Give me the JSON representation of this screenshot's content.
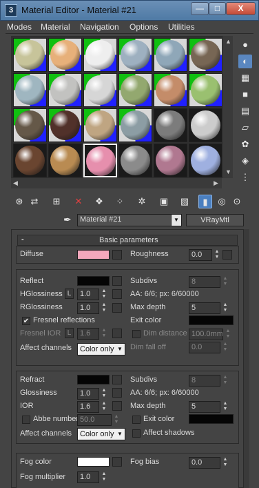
{
  "window": {
    "title": "Material Editor - Material #21",
    "app_icon": "3",
    "min_label": "—",
    "max_label": "□",
    "close_label": "X"
  },
  "menu": [
    "Modes",
    "Material",
    "Navigation",
    "Options",
    "Utilities"
  ],
  "slots_rows": [
    [
      {
        "c": "#c7c49a",
        "used": true
      },
      {
        "c": "#e7b07a",
        "used": true
      },
      {
        "c": "#eeeeee",
        "used": true
      },
      {
        "c": "#9eb0c0",
        "used": true
      },
      {
        "c": "#8fa7b8",
        "used": true
      },
      {
        "c": "#776654",
        "used": true
      }
    ],
    [
      {
        "c": "#9fb6c0",
        "used": true
      },
      {
        "c": "#c2c2c0",
        "used": true
      },
      {
        "c": "#d6d6d6",
        "used": true
      },
      {
        "c": "#93a86f",
        "used": true
      },
      {
        "c": "#c48c69",
        "used": true
      },
      {
        "c": "#9ac070",
        "used": true
      }
    ],
    [
      {
        "c": "#655848",
        "used": true
      },
      {
        "c": "#51312a",
        "used": true
      },
      {
        "c": "#bfa582",
        "used": true
      },
      {
        "c": "#8c9da4",
        "used": true
      },
      {
        "c": "#7c7c7c",
        "used": false
      },
      {
        "c": "#cccccc",
        "used": false
      }
    ],
    [
      {
        "c": "#6a4530",
        "used": false
      },
      {
        "c": "#b98b52",
        "used": false
      },
      {
        "c": "#e68fad",
        "used": false,
        "selected": true
      },
      {
        "c": "#8b8b8b",
        "used": false
      },
      {
        "c": "#b07890",
        "used": false
      },
      {
        "c": "#9fb0e0",
        "used": false
      }
    ]
  ],
  "side_tools": [
    {
      "name": "sample-type-icon",
      "glyph": "●"
    },
    {
      "name": "backlight-icon",
      "glyph": "◐"
    },
    {
      "name": "background-icon",
      "glyph": "▦"
    },
    {
      "name": "sample-uv-icon",
      "glyph": "■"
    },
    {
      "name": "video-color-icon",
      "glyph": "▤"
    },
    {
      "name": "make-preview-icon",
      "glyph": "▱"
    },
    {
      "name": "options-icon",
      "glyph": "✿"
    },
    {
      "name": "select-by-material-icon",
      "glyph": "◈"
    },
    {
      "name": "material-map-navigator-icon",
      "glyph": "⋮"
    }
  ],
  "toolbar": [
    {
      "name": "get-material-icon",
      "glyph": "⊛"
    },
    {
      "name": "put-to-scene-icon",
      "glyph": "⇄"
    },
    {
      "name": "assign-to-selection-icon",
      "glyph": "⊞"
    },
    {
      "name": "reset-map-icon",
      "glyph": "✕",
      "color": "#e04040"
    },
    {
      "name": "make-unique-icon",
      "glyph": "❖"
    },
    {
      "name": "put-to-library-icon",
      "glyph": "⁘"
    },
    {
      "name": "material-id-channel-icon",
      "glyph": "✲"
    },
    {
      "name": "show-shaded-icon",
      "glyph": "▣"
    },
    {
      "name": "show-end-result-icon",
      "glyph": "▧"
    },
    {
      "name": "go-to-parent-icon",
      "glyph": "▮",
      "active": true
    },
    {
      "name": "go-forward-sibling-icon",
      "glyph": "◎"
    },
    {
      "name": "pick-material-icon",
      "glyph": "⊙"
    }
  ],
  "name_row": {
    "eyedropper": "✒",
    "material_name": "Material #21",
    "type_button": "VRayMtl"
  },
  "rollout": {
    "minus": "-",
    "title": "Basic parameters"
  },
  "diffuse": {
    "label": "Diffuse",
    "color": "#f4a8bc",
    "roughness_label": "Roughness",
    "roughness": "0.0"
  },
  "reflection": {
    "reflect_label": "Reflect",
    "reflect_color": "#050505",
    "subdivs_label": "Subdivs",
    "subdivs": "8",
    "hgloss_label": "HGlossiness",
    "hgloss": "1.0",
    "l_label": "L",
    "aa_text": "AA: 6/6; px: 6/60000",
    "rgloss_label": "RGlossiness",
    "rgloss": "1.0",
    "maxdepth_label": "Max depth",
    "maxdepth": "5",
    "fresnel_label": "Fresnel reflections",
    "fresnel_checked": "✔",
    "exitcolor_label": "Exit color",
    "exit_color": "#050505",
    "fresnel_ior_label": "Fresnel IOR",
    "fresnel_ior": "1.6",
    "dimdistance_label": "Dim distance",
    "dimdistance": "100.0mm",
    "affect_label": "Affect channels",
    "affect_value": "Color only",
    "dimfalloff_label": "Dim fall off",
    "dimfalloff": "0.0"
  },
  "refraction": {
    "refract_label": "Refract",
    "refract_color": "#050505",
    "subdivs_label": "Subdivs",
    "subdivs": "8",
    "gloss_label": "Glossiness",
    "gloss": "1.0",
    "aa_text": "AA: 6/6; px: 6/60000",
    "ior_label": "IOR",
    "ior": "1.6",
    "maxdepth_label": "Max depth",
    "maxdepth": "5",
    "abbe_label": "Abbe number",
    "abbe": "50.0",
    "exitcolor_label": "Exit color",
    "exit_color": "#050505",
    "affect_label": "Affect channels",
    "affect_value": "Color only",
    "affect_shadows_label": "Affect shadows"
  },
  "fog": {
    "color_label": "Fog color",
    "color": "#ffffff",
    "bias_label": "Fog bias",
    "bias": "0.0",
    "mult_label": "Fog multiplier",
    "mult": "1.0"
  }
}
